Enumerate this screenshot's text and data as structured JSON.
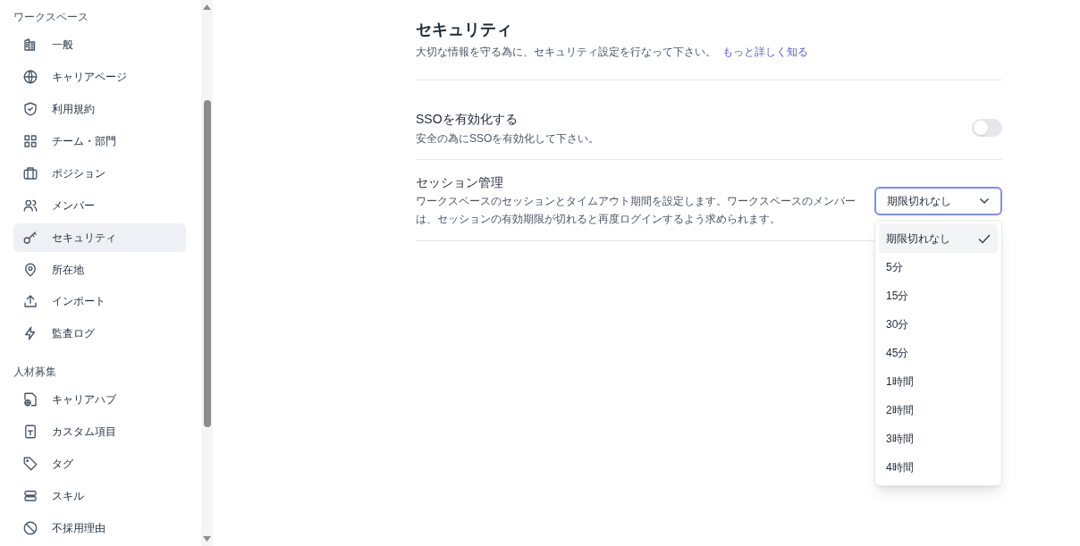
{
  "sidebar": {
    "sections": [
      {
        "title": "ワークスペース",
        "items": [
          {
            "label": "一般",
            "selected": false
          },
          {
            "label": "キャリアページ",
            "selected": false
          },
          {
            "label": "利用規約",
            "selected": false
          },
          {
            "label": "チーム・部門",
            "selected": false
          },
          {
            "label": "ポジション",
            "selected": false
          },
          {
            "label": "メンバー",
            "selected": false
          },
          {
            "label": "セキュリティ",
            "selected": true
          },
          {
            "label": "所在地",
            "selected": false
          },
          {
            "label": "インポート",
            "selected": false
          },
          {
            "label": "監査ログ",
            "selected": false
          }
        ]
      },
      {
        "title": "人材募集",
        "items": [
          {
            "label": "キャリアハブ",
            "selected": false
          },
          {
            "label": "カスタム項目",
            "selected": false
          },
          {
            "label": "タグ",
            "selected": false
          },
          {
            "label": "スキル",
            "selected": false
          },
          {
            "label": "不採用理由",
            "selected": false
          }
        ]
      }
    ]
  },
  "page": {
    "title": "セキュリティ",
    "description": "大切な情報を守る為に、セキュリティ設定を行なって下さい。",
    "link": "もっと詳しく知る"
  },
  "sso": {
    "title": "SSOを有効化する",
    "description": "安全の為にSSOを有効化して下さい。",
    "on": false
  },
  "session": {
    "title": "セッション管理",
    "description": "ワークスペースのセッションとタイムアウト期間を設定します。ワークスペースのメンバーは、セッションの有効期限が切れると再度ログインするよう求められます。",
    "value": "期限切れなし",
    "expanded": true,
    "options": [
      {
        "label": "期限切れなし",
        "selected": true
      },
      {
        "label": "5分",
        "selected": false
      },
      {
        "label": "15分",
        "selected": false
      },
      {
        "label": "30分",
        "selected": false
      },
      {
        "label": "45分",
        "selected": false
      },
      {
        "label": "1時間",
        "selected": false
      },
      {
        "label": "2時間",
        "selected": false
      },
      {
        "label": "3時間",
        "selected": false
      },
      {
        "label": "4時間",
        "selected": false
      }
    ]
  }
}
